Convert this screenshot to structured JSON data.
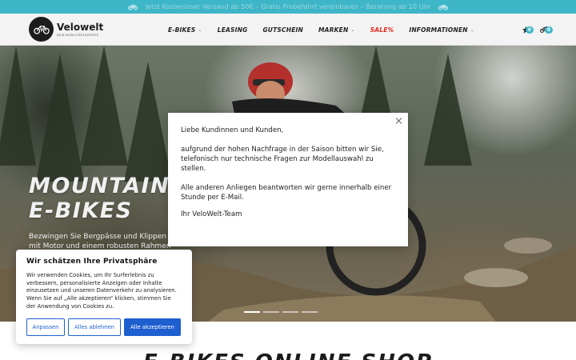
{
  "promo": {
    "text": "Jetzt Kostenloser Versand ab 50€ – Gratis Probefahrt vereinbaren – Beratung ab 10 Uhr"
  },
  "header": {
    "logo_name": "Velowelt",
    "logo_tagline": "DEIN MOBILITÄTSEXPERTE",
    "nav": [
      {
        "label": "E-BIKES",
        "has_dropdown": true
      },
      {
        "label": "LEASING",
        "has_dropdown": false
      },
      {
        "label": "GUTSCHEIN",
        "has_dropdown": false
      },
      {
        "label": "MARKEN",
        "has_dropdown": true
      },
      {
        "label": "SALE%",
        "has_dropdown": false
      },
      {
        "label": "INFORMATIONEN",
        "has_dropdown": true
      }
    ],
    "wishlist_count": "0",
    "cart_count": "0"
  },
  "hero": {
    "title_line1": "MOUNTAIN",
    "title_line2": "E-BIKES",
    "subtitle": "Bezwingen Sie Bergpässe und Klippen mit Motor und einem robusten Rahmen"
  },
  "modal": {
    "greeting": "Liebe Kundinnen und Kunden,",
    "paragraph1": "aufgrund der hohen Nachfrage in der Saison bitten wir Sie, telefonisch nur technische Fragen zur Modellauswahl zu stellen.",
    "paragraph2": "Alle anderen Anliegen beantworten wir gerne innerhalb einer Stunde per E-Mail.",
    "signature": "Ihr VeloWelt-Team"
  },
  "cookie": {
    "title": "Wir schätzen Ihre Privatsphäre",
    "text": "Wir verwenden Cookies, um Ihr Surferlebnis zu verbessern, personalisierte Anzeigen oder Inhalte einzusetzen und unseren Datenverkehr zu analysieren. Wenn Sie auf „Alle akzeptieren“ klicken, stimmen Sie der Anwendung von Cookies zu.",
    "btn_customize": "Anpassen",
    "btn_reject": "Alles ablehnen",
    "btn_accept": "Alle akzeptieren"
  },
  "section_heading": "E-BIKES ONLINE SHOP",
  "colors": {
    "accent": "#3fb6c7",
    "sale": "#e1261c",
    "cookie_primary": "#1e5fd0"
  },
  "icons": [
    "bicycle-icon",
    "chevron-down-icon",
    "wishlist-star-icon",
    "cart-bike-icon",
    "close-icon"
  ]
}
